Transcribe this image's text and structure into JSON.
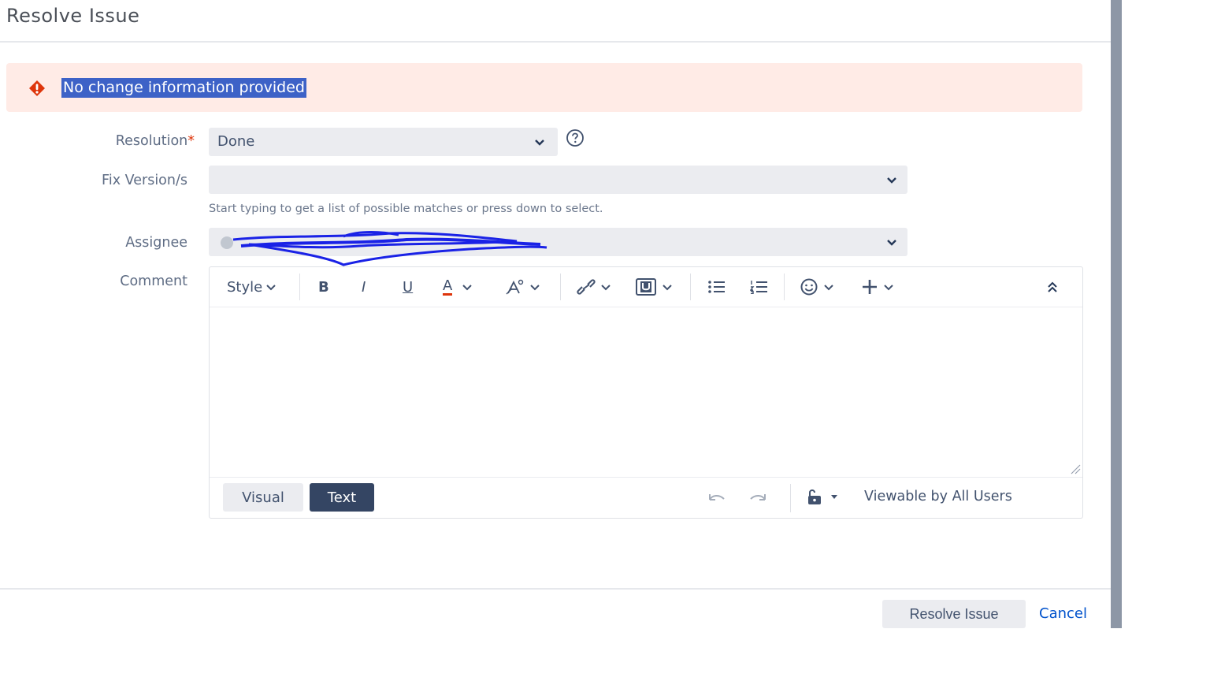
{
  "dialog": {
    "title": "Resolve Issue"
  },
  "error": {
    "message": "No change information provided",
    "color": "#de350b"
  },
  "form": {
    "resolution": {
      "label": "Resolution",
      "required_mark": "*",
      "value": "Done"
    },
    "fix_versions": {
      "label": "Fix Version/s",
      "value": "",
      "hint": "Start typing to get a list of possible matches or press down to select."
    },
    "assignee": {
      "label": "Assignee",
      "value": ""
    },
    "comment": {
      "label": "Comment"
    }
  },
  "editor": {
    "toolbar": {
      "style_label": "Style",
      "bold_label": "B",
      "italic_label": "I",
      "underline_label": "U",
      "text_color_label": "A",
      "text_color_accent": "#de350b",
      "icons": [
        "chevron-down-icon",
        "text-effects-icon",
        "link-icon",
        "attachment-icon",
        "bullet-list-icon",
        "numbered-list-icon",
        "emoticon-icon",
        "plus-icon",
        "collapse-icon"
      ]
    },
    "modes": {
      "visual": "Visual",
      "text": "Text",
      "active": "Text"
    },
    "visibility": "Viewable by All Users"
  },
  "footer": {
    "resolve_label": "Resolve Issue",
    "cancel_label": "Cancel"
  },
  "colors": {
    "banner_bg": "#ffebe6",
    "selection_bg": "#3d62c7",
    "link": "#0052cc",
    "active_tab": "#344563"
  }
}
